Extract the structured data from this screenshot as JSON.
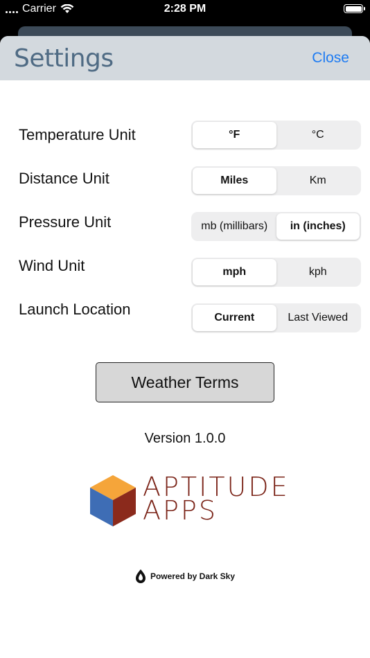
{
  "status_bar": {
    "carrier": "Carrier",
    "time": "2:28 PM"
  },
  "header": {
    "title": "Settings",
    "close_label": "Close"
  },
  "settings": {
    "temperature": {
      "label": "Temperature Unit",
      "options": [
        "°F",
        "°C"
      ],
      "selected": "°F"
    },
    "distance": {
      "label": "Distance Unit",
      "options": [
        "Miles",
        "Km"
      ],
      "selected": "Miles"
    },
    "pressure": {
      "label": "Pressure Unit",
      "options": [
        "mb (millibars)",
        "in (inches)"
      ],
      "selected": "in (inches)"
    },
    "wind": {
      "label": "Wind Unit",
      "options": [
        "mph",
        "kph"
      ],
      "selected": "mph"
    },
    "launch": {
      "label": "Launch Location",
      "options": [
        "Current",
        "Last Viewed"
      ],
      "selected": "Current"
    }
  },
  "terms_button_label": "Weather Terms",
  "version": "Version 1.0.0",
  "logo": {
    "line1": "APTITUDE",
    "line2": "APPS",
    "colors": {
      "top": "#f5a53a",
      "left": "#3e6db5",
      "right": "#8b2a1c",
      "text": "#7b2418"
    }
  },
  "powered_by": "Powered by Dark Sky"
}
